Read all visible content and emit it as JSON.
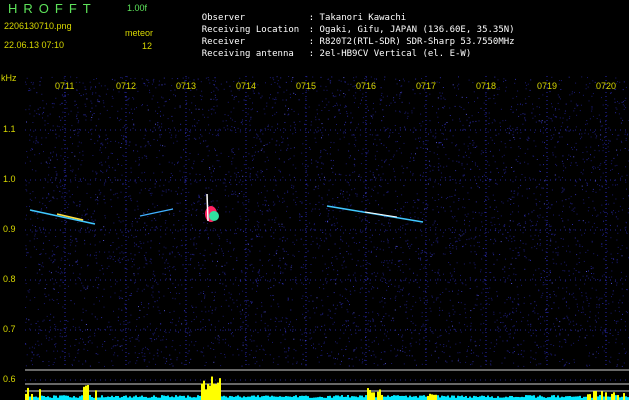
{
  "header": {
    "app_name": "HROFFT",
    "version": "1.00f",
    "filename": "2206130710.png",
    "datetime": "22.06.13 07:10",
    "mode": "meteor",
    "count": "12"
  },
  "info": [
    {
      "label": "Observer",
      "value": ": Takanori Kawachi"
    },
    {
      "label": "Receiving Location",
      "value": ": Ogaki, Gifu, JAPAN (136.60E, 35.35N)"
    },
    {
      "label": "Receiver",
      "value": ": R820T2(RTL-SDR) SDR-Sharp 53.7550MHz"
    },
    {
      "label": "Receiving antenna",
      "value": ": 2el-HB9CV Vertical (el. E-W)"
    }
  ],
  "axis": {
    "unit": "kHz",
    "y_ticks": [
      "1.1",
      "1.0",
      "0.9",
      "0.8",
      "0.7",
      "0.6"
    ],
    "x_ticks": [
      "0711",
      "0712",
      "0713",
      "0714",
      "0715",
      "0716",
      "0717",
      "0718",
      "0719",
      "0720"
    ]
  },
  "colors": {
    "label": "#d8d800",
    "grid": "#3a3aff",
    "noise": "#1a1a70",
    "bar": "#00e8ff",
    "burst": "#ffff00"
  }
}
